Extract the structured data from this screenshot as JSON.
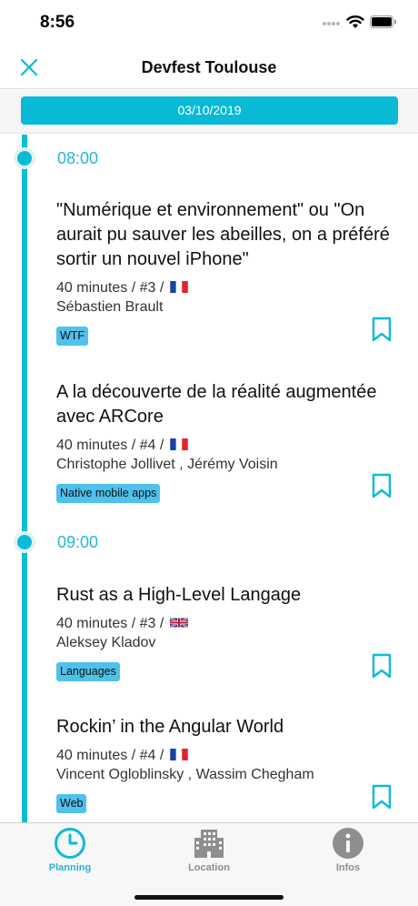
{
  "status_bar": {
    "time": "8:56"
  },
  "nav": {
    "title": "Devfest Toulouse",
    "close_icon": "close-icon"
  },
  "date": {
    "label": "03/10/2019"
  },
  "slots": [
    {
      "time": "08:00",
      "talks": [
        {
          "title": "\"Numérique et environnement\" ou \"On aurait pu sauver les abeilles, on a préféré sortir un nouvel iPhone\"",
          "meta": "40 minutes / #3 /",
          "flag": "fr-flag-icon",
          "speakers": "Sébastien Brault",
          "tag": "WTF"
        },
        {
          "title": "A la découverte de la réalité augmentée avec ARCore",
          "meta": "40 minutes / #4 /",
          "flag": "fr-flag-icon",
          "speakers": "Christophe Jollivet , Jérémy Voisin",
          "tag": "Native mobile apps"
        }
      ]
    },
    {
      "time": "09:00",
      "talks": [
        {
          "title": "Rust as a High-Level Langage",
          "meta": "40 minutes / #3 /",
          "flag": "uk-flag-icon",
          "speakers": "Aleksey Kladov",
          "tag": "Languages"
        },
        {
          "title": "Rockin’ in the Angular World",
          "meta": "40 minutes / #4 /",
          "flag": "fr-flag-icon",
          "speakers": "Vincent Ogloblinsky , Wassim Chegham",
          "tag": "Web"
        }
      ]
    }
  ],
  "tabs": [
    {
      "label": "Planning",
      "icon": "clock-icon",
      "active": true
    },
    {
      "label": "Location",
      "icon": "building-icon",
      "active": false
    },
    {
      "label": "Infos",
      "icon": "info-icon",
      "active": false
    }
  ],
  "colors": {
    "accent": "#0abcd6",
    "tag": "#4ec1ec",
    "inactive": "#8e8e8e"
  }
}
